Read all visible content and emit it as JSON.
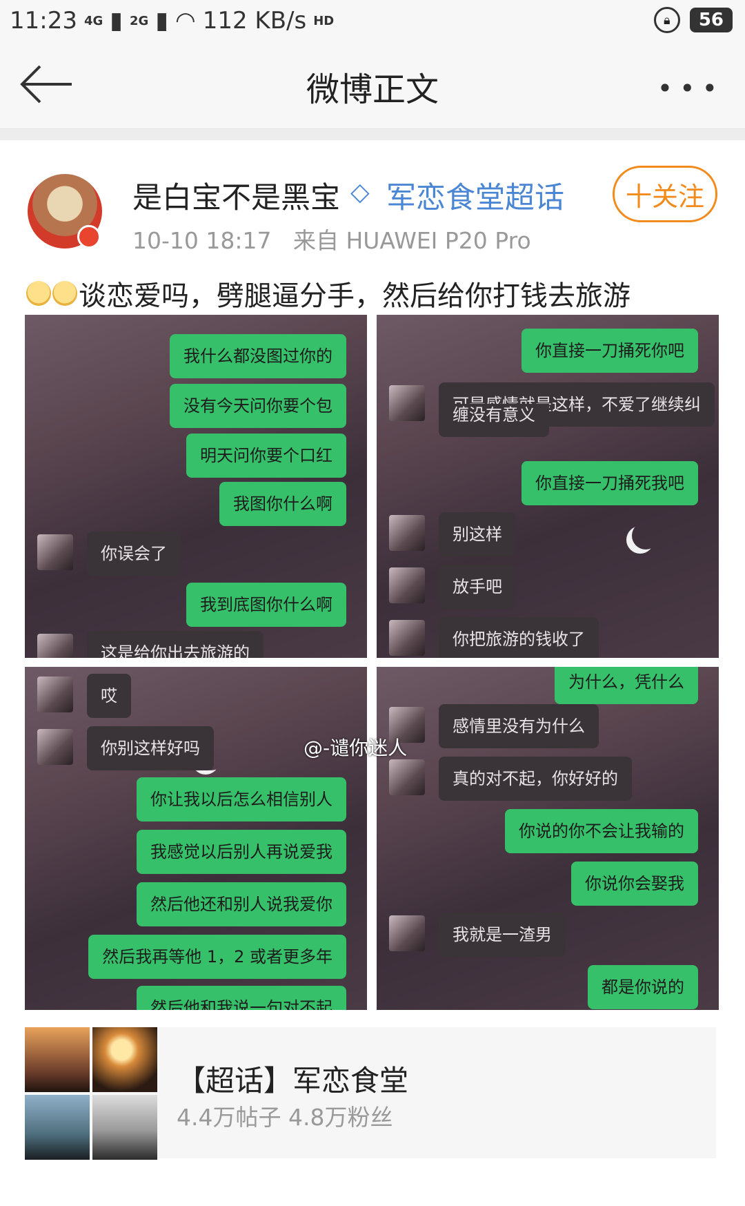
{
  "status_bar": {
    "time": "11:23",
    "net1": "4G",
    "net2": "2G",
    "speed": "112 KB/s",
    "hd": "HD",
    "battery": "56"
  },
  "nav": {
    "title": "微博正文"
  },
  "post": {
    "username": "是白宝不是黑宝",
    "topic": "军恋食堂超话",
    "time": "10-10 18:17",
    "source": "来自 HUAWEI P20 Pro",
    "follow_label": "十关注",
    "text": "谈恋爱吗，劈腿逼分手，然后给你打钱去旅游"
  },
  "images": [
    {
      "messages": [
        {
          "side": "me",
          "text": "我什么都没图过你的"
        },
        {
          "side": "me",
          "text": "没有今天问你要个包"
        },
        {
          "side": "me",
          "text": "明天问你要个口红"
        },
        {
          "side": "me",
          "text": "我图你什么啊"
        },
        {
          "side": "other",
          "text": "你误会了"
        },
        {
          "side": "me",
          "text": "我到底图你什么啊"
        },
        {
          "side": "other",
          "text": "这是给你出去旅游的"
        }
      ]
    },
    {
      "messages": [
        {
          "side": "me",
          "text": "你直接一刀捅死你吧"
        },
        {
          "side": "other",
          "text": "可是感情就是这样，不爱了继续纠"
        },
        {
          "side": "other",
          "text": "缠没有意义"
        },
        {
          "side": "me",
          "text": "你直接一刀捅死我吧"
        },
        {
          "side": "other",
          "text": "别这样"
        },
        {
          "side": "other",
          "text": "放手吧"
        },
        {
          "side": "other",
          "text": "你把旅游的钱收了"
        }
      ]
    },
    {
      "messages": [
        {
          "side": "other",
          "text": "哎"
        },
        {
          "side": "other",
          "text": "你别这样好吗"
        },
        {
          "side": "me",
          "text": "你让我以后怎么相信别人"
        },
        {
          "side": "me",
          "text": "我感觉以后别人再说爱我"
        },
        {
          "side": "me",
          "text": "然后他还和别人说我爱你"
        },
        {
          "side": "me",
          "text": "然后我再等他 1，2 或者更多年"
        },
        {
          "side": "me",
          "text": "然后他和我说一句对不起"
        }
      ]
    },
    {
      "messages": [
        {
          "side": "me",
          "text": "为什么，凭什么"
        },
        {
          "side": "other",
          "text": "感情里没有为什么"
        },
        {
          "side": "other",
          "text": "真的对不起，你好好的"
        },
        {
          "side": "me",
          "text": "你说的你不会让我输的"
        },
        {
          "side": "me",
          "text": "你说你会娶我"
        },
        {
          "side": "other",
          "text": "我就是一渣男"
        },
        {
          "side": "me",
          "text": "都是你说的"
        }
      ]
    }
  ],
  "watermark": "@-谴你迷人",
  "card": {
    "title": "【超话】军恋食堂",
    "stats": "4.4万帖子 4.8万粉丝"
  },
  "colors": {
    "accent": "#f28a1c",
    "link": "#4a86d4",
    "bubble_me": "#36c06a",
    "bubble_other": "#3a3438"
  }
}
